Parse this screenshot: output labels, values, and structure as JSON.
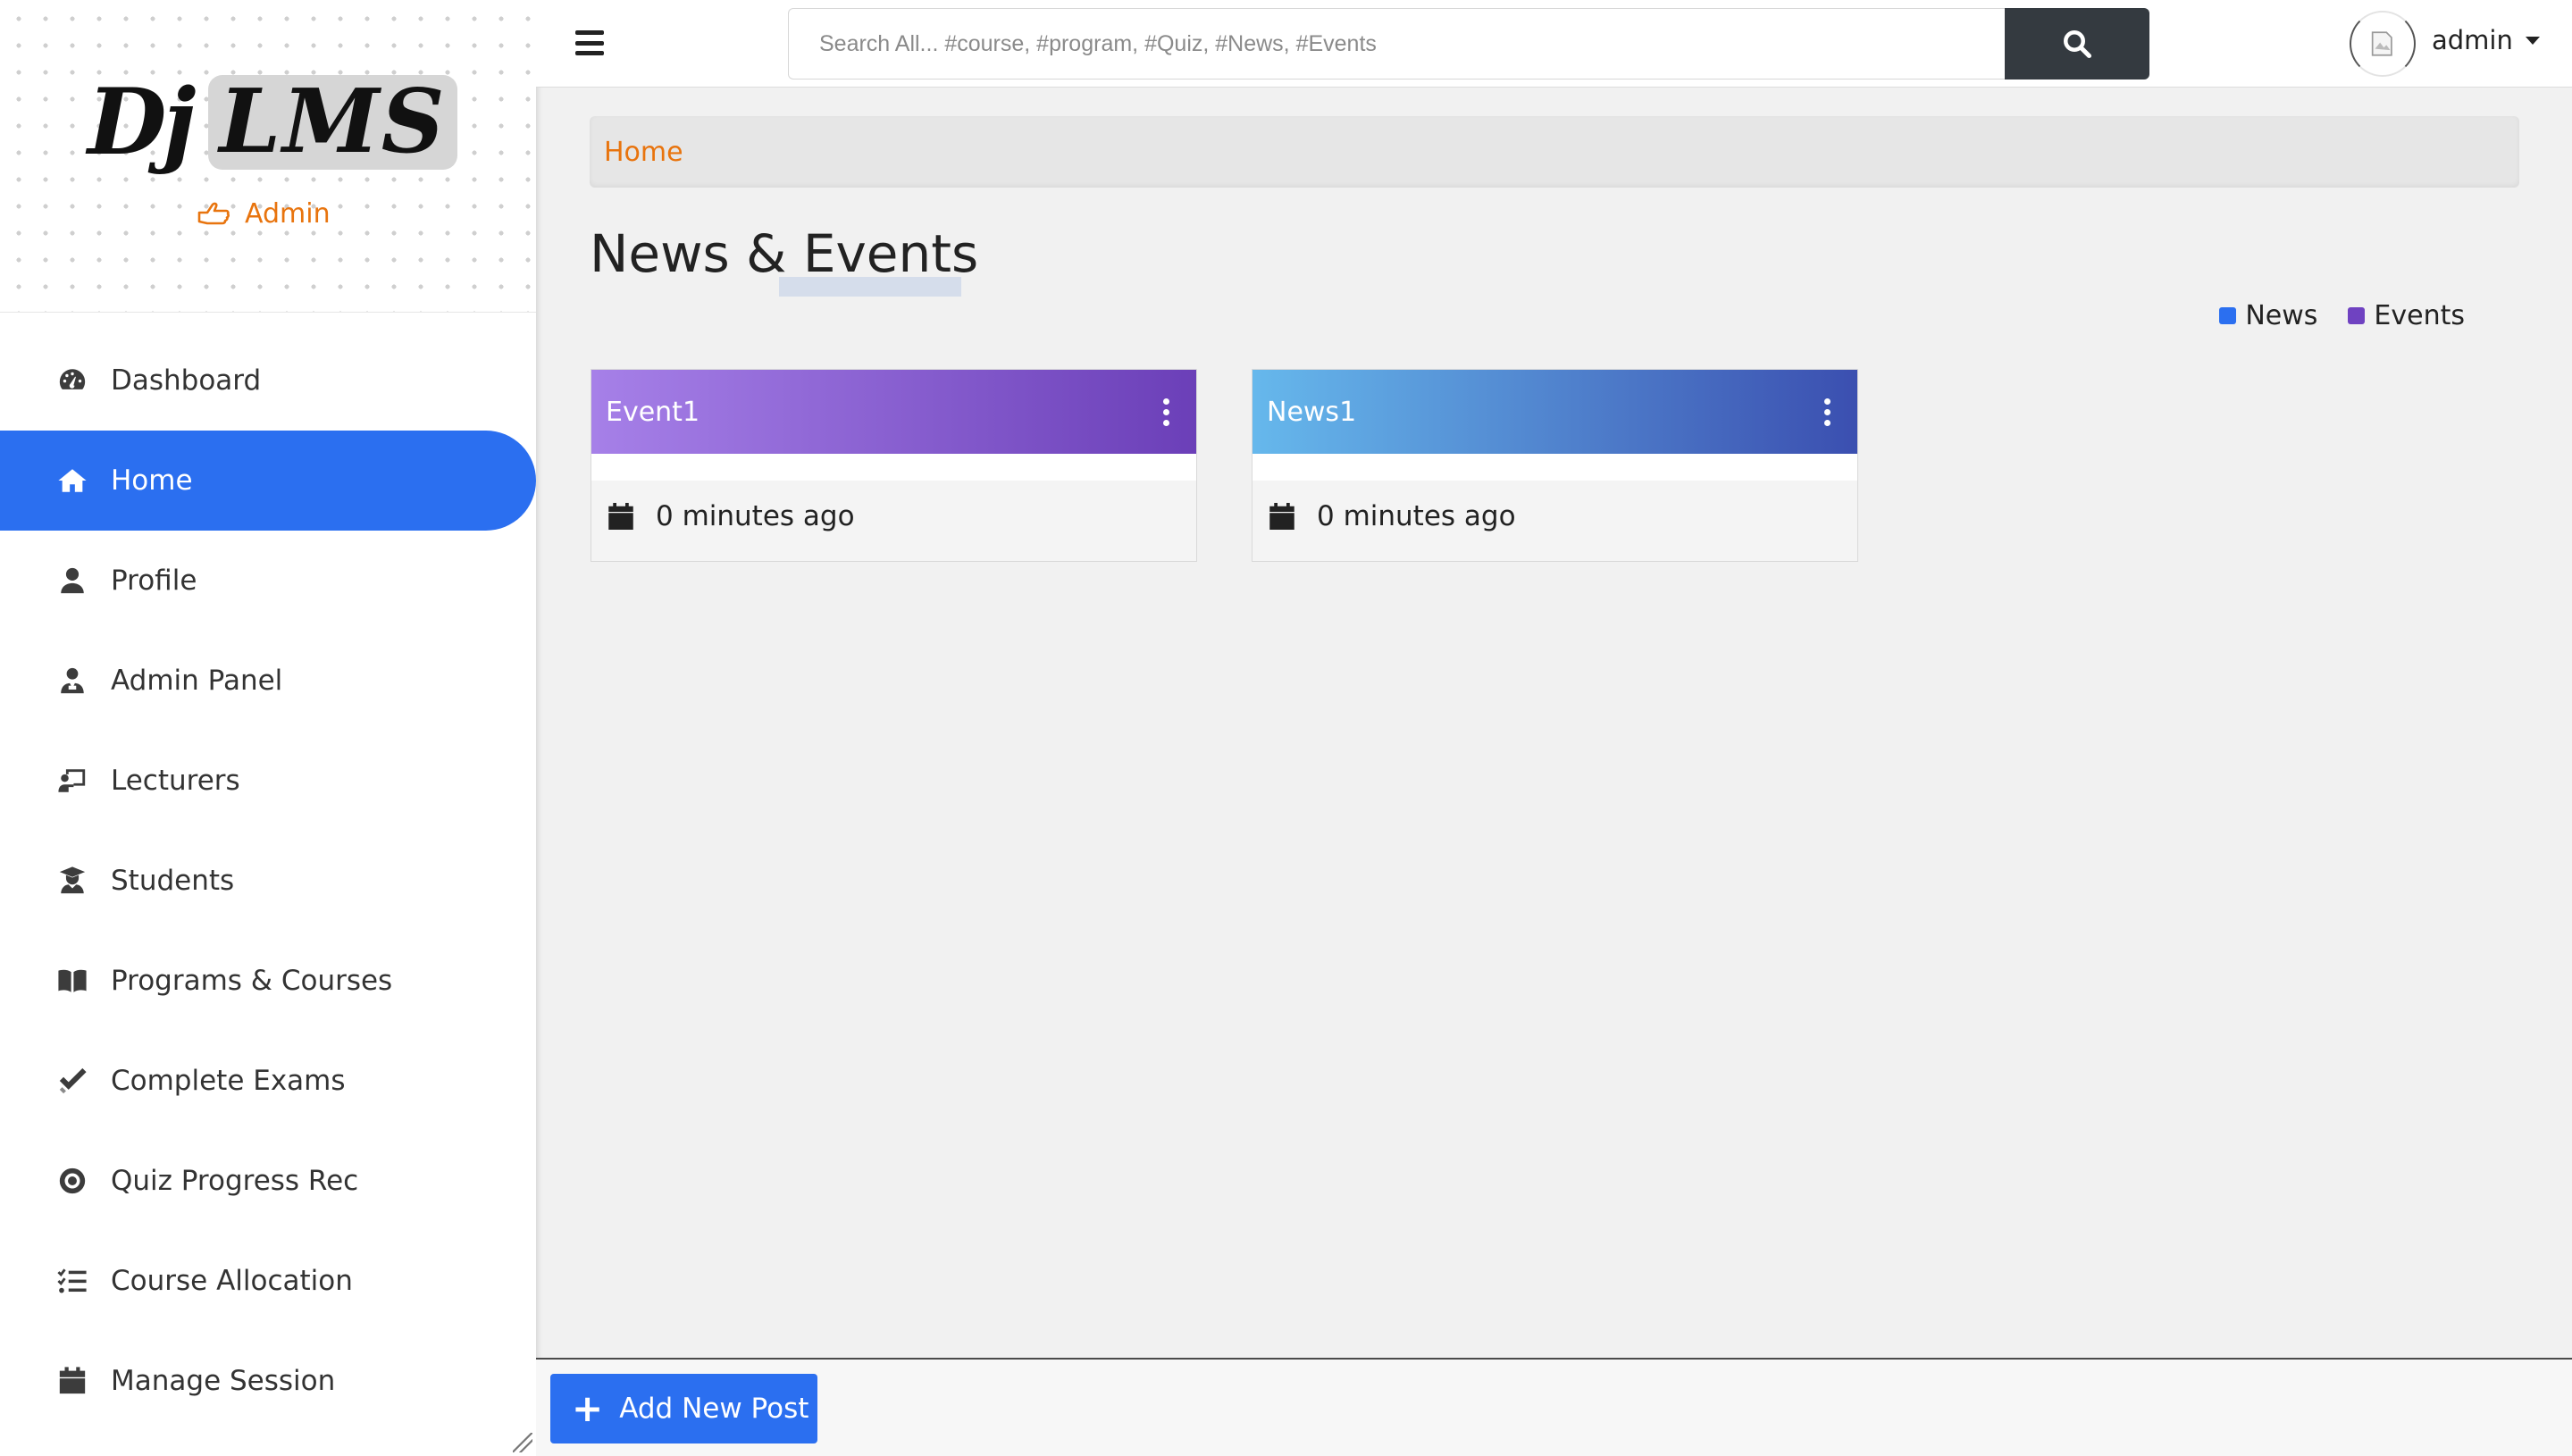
{
  "brand": {
    "logo_dj": "Dj",
    "logo_lms": "LMS",
    "role": "Admin"
  },
  "sidebar": {
    "items": [
      {
        "label": "Dashboard",
        "icon": "dashboard-icon",
        "active": false
      },
      {
        "label": "Home",
        "icon": "home-icon",
        "active": true
      },
      {
        "label": "Profile",
        "icon": "user-icon",
        "active": false
      },
      {
        "label": "Admin Panel",
        "icon": "user-tie-icon",
        "active": false
      },
      {
        "label": "Lecturers",
        "icon": "chalkboard-teacher-icon",
        "active": false
      },
      {
        "label": "Students",
        "icon": "user-graduate-icon",
        "active": false
      },
      {
        "label": "Programs & Courses",
        "icon": "book-open-icon",
        "active": false
      },
      {
        "label": "Complete Exams",
        "icon": "check-double-icon",
        "active": false
      },
      {
        "label": "Quiz Progress Rec",
        "icon": "record-icon",
        "active": false
      },
      {
        "label": "Course Allocation",
        "icon": "tasks-icon",
        "active": false
      },
      {
        "label": "Manage Session",
        "icon": "calendar-icon",
        "active": false
      }
    ]
  },
  "topbar": {
    "search_placeholder": "Search All... #course, #program, #Quiz, #News, #Events",
    "username": "admin"
  },
  "breadcrumb": {
    "home": "Home"
  },
  "page": {
    "title": "News & Events"
  },
  "legend": [
    {
      "label": "News",
      "color": "#2b6ff0"
    },
    {
      "label": "Events",
      "color": "#6f42c1"
    }
  ],
  "cards": [
    {
      "title": "Event1",
      "time": "0 minutes ago",
      "type": "event"
    },
    {
      "title": "News1",
      "time": "0 minutes ago",
      "type": "news"
    }
  ],
  "actions": {
    "add_post": "Add New Post"
  },
  "colors": {
    "accent": "#2b6ff0",
    "orange": "#e8740e",
    "dark": "#343a40",
    "event_gradient": [
      "#a680e8",
      "#6b3fb8"
    ],
    "news_gradient": [
      "#66b8ec",
      "#3b4fb0"
    ]
  }
}
